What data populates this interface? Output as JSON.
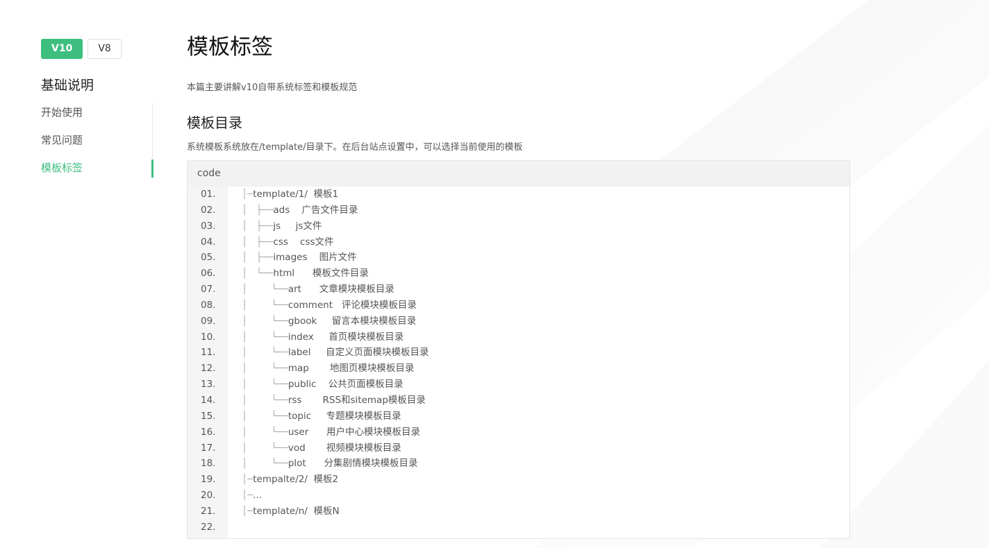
{
  "sidebar": {
    "versions": [
      {
        "label": "V10",
        "active": true
      },
      {
        "label": "V8",
        "active": false
      }
    ],
    "section_title": "基础说明",
    "items": [
      {
        "label": "开始使用",
        "active": false
      },
      {
        "label": "常见问题",
        "active": false
      },
      {
        "label": "模板标签",
        "active": true
      }
    ]
  },
  "main": {
    "title": "模板标签",
    "intro": "本篇主要讲解v10自带系统标签和模板规范",
    "section_title": "模板目录",
    "section_desc": "系统模板系统放在/template/目录下。在后台站点设置中，可以选择当前使用的模板",
    "code": {
      "header": "code",
      "lines": [
        {
          "num": "01.",
          "tree": "│─",
          "text": "template/1/  模板1"
        },
        {
          "num": "02.",
          "tree": "│   ├──",
          "text": "ads    广告文件目录"
        },
        {
          "num": "03.",
          "tree": "│   ├──",
          "text": "js     js文件"
        },
        {
          "num": "04.",
          "tree": "│   ├──",
          "text": "css    css文件"
        },
        {
          "num": "05.",
          "tree": "│   ├──",
          "text": "images    图片文件"
        },
        {
          "num": "06.",
          "tree": "│   └──",
          "text": "html      模板文件目录"
        },
        {
          "num": "07.",
          "tree": "│        └──",
          "text": "art      文章模块模板目录"
        },
        {
          "num": "08.",
          "tree": "│        └──",
          "text": "comment   评论模块模板目录"
        },
        {
          "num": "09.",
          "tree": "│        └──",
          "text": "gbook     留言本模块模板目录"
        },
        {
          "num": "10.",
          "tree": "│        └──",
          "text": "index     首页模块模板目录"
        },
        {
          "num": "11.",
          "tree": "│        └──",
          "text": "label     自定义页面模块模板目录"
        },
        {
          "num": "12.",
          "tree": "│        └──",
          "text": "map       地图页模块模板目录"
        },
        {
          "num": "13.",
          "tree": "│        └──",
          "text": "public    公共页面模板目录"
        },
        {
          "num": "14.",
          "tree": "│        └──",
          "text": "rss       RSS和sitemap模板目录"
        },
        {
          "num": "15.",
          "tree": "│        └──",
          "text": "topic     专题模块模板目录"
        },
        {
          "num": "16.",
          "tree": "│        └──",
          "text": "user      用户中心模块模板目录"
        },
        {
          "num": "17.",
          "tree": "│        └──",
          "text": "vod       视频模块模板目录"
        },
        {
          "num": "18.",
          "tree": "│        └──",
          "text": "plot      分集剧情模块模板目录"
        },
        {
          "num": "19.",
          "tree": "│─",
          "text": "tempalte/2/  模板2"
        },
        {
          "num": "20.",
          "tree": "│─",
          "text": "..."
        },
        {
          "num": "21.",
          "tree": "│─",
          "text": "template/n/  模板N"
        },
        {
          "num": "22.",
          "tree": "",
          "text": ""
        }
      ]
    }
  },
  "colors": {
    "accent": "#3dbe7e",
    "text": "#333333",
    "muted": "#555555",
    "code_bg": "#f5f5f5"
  }
}
